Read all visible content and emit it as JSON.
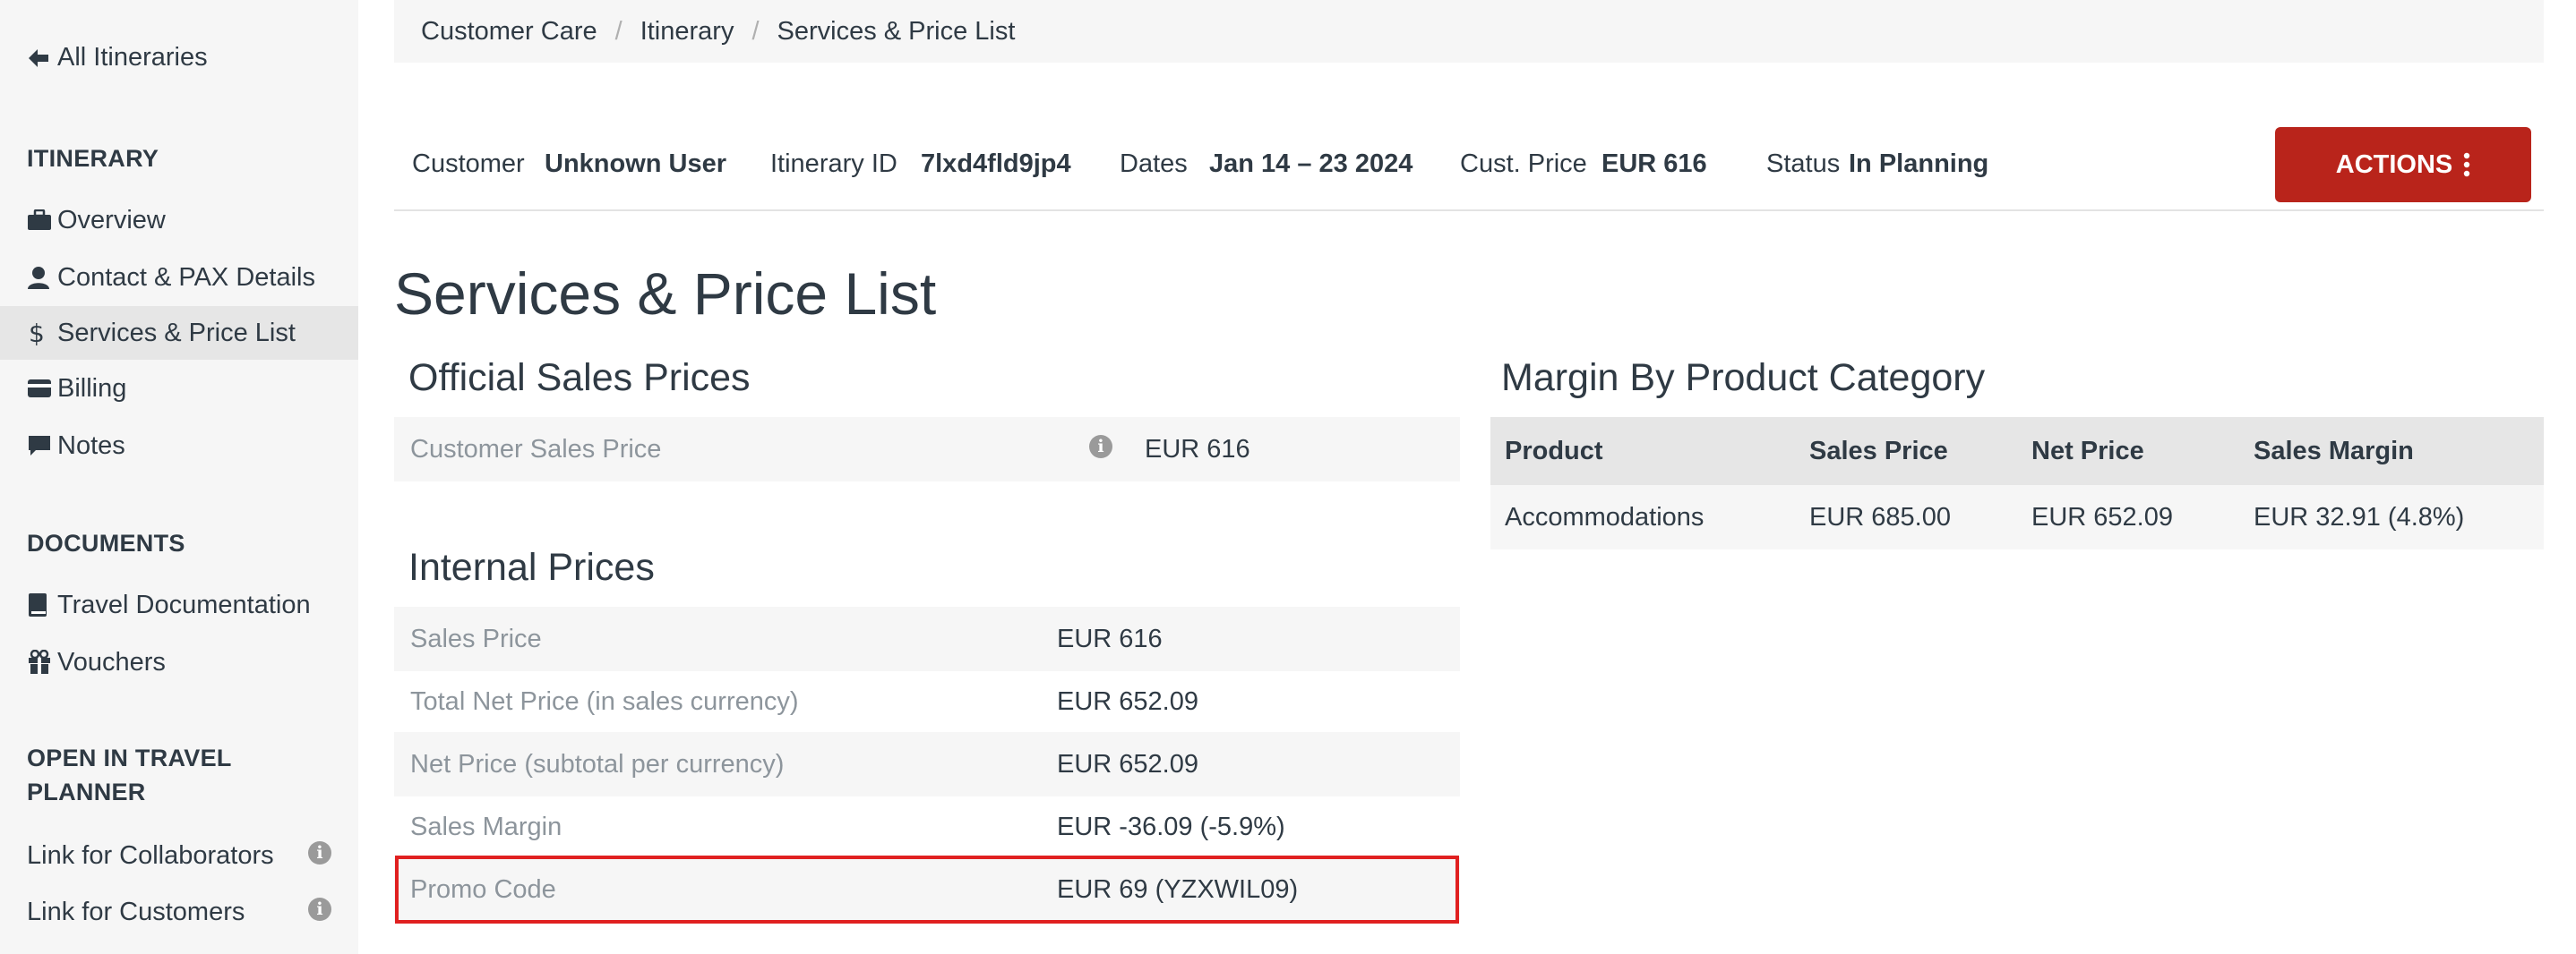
{
  "sidebar": {
    "back_label": "All Itineraries",
    "itinerary_heading": "ITINERARY",
    "itinerary_items": [
      {
        "label": "Overview",
        "icon": "briefcase-icon"
      },
      {
        "label": "Contact & PAX Details",
        "icon": "user-icon"
      },
      {
        "label": "Services & Price List",
        "icon": "dollar-icon"
      },
      {
        "label": "Billing",
        "icon": "credit-card-icon"
      },
      {
        "label": "Notes",
        "icon": "comment-icon"
      }
    ],
    "documents_heading": "DOCUMENTS",
    "document_items": [
      {
        "label": "Travel Documentation",
        "icon": "book-icon"
      },
      {
        "label": "Vouchers",
        "icon": "gift-icon"
      }
    ],
    "planner_heading_line1": "OPEN IN TRAVEL",
    "planner_heading_line2": "PLANNER",
    "planner_links": [
      {
        "label": "Link for Collaborators"
      },
      {
        "label": "Link for Customers"
      }
    ]
  },
  "breadcrumb": [
    "Customer Care",
    "Itinerary",
    "Services & Price List"
  ],
  "summary": {
    "customer_label": "Customer",
    "customer_value": "Unknown User",
    "id_label": "Itinerary ID",
    "id_value": "7lxd4fld9jp4",
    "dates_label": "Dates",
    "dates_value": "Jan 14 – 23 2024",
    "price_label": "Cust. Price",
    "price_value": "EUR 616",
    "status_label": "Status",
    "status_value": "In Planning"
  },
  "actions_label": "ACTIONS",
  "page_title": "Services & Price List",
  "official": {
    "title": "Official Sales Prices",
    "rows": [
      {
        "label": "Customer Sales Price",
        "value": "EUR 616"
      }
    ]
  },
  "internal": {
    "title": "Internal Prices",
    "rows": [
      {
        "label": "Sales Price",
        "value": "EUR 616"
      },
      {
        "label": "Total Net Price (in sales currency)",
        "value": "EUR 652.09"
      },
      {
        "label": "Net Price (subtotal per currency)",
        "value": "EUR 652.09"
      },
      {
        "label": "Sales Margin",
        "value": "EUR -36.09 (-5.9%)"
      },
      {
        "label": "Promo Code",
        "value": "EUR 69 (YZXWIL09)"
      }
    ]
  },
  "margin": {
    "title": "Margin By Product Category",
    "headers": [
      "Product",
      "Sales Price",
      "Net Price",
      "Sales Margin"
    ],
    "rows": [
      [
        "Accommodations",
        "EUR 685.00",
        "EUR 652.09",
        "EUR 32.91 (4.8%)"
      ]
    ]
  },
  "colors": {
    "accent": "#b9241b",
    "highlight_border": "#e02020"
  }
}
